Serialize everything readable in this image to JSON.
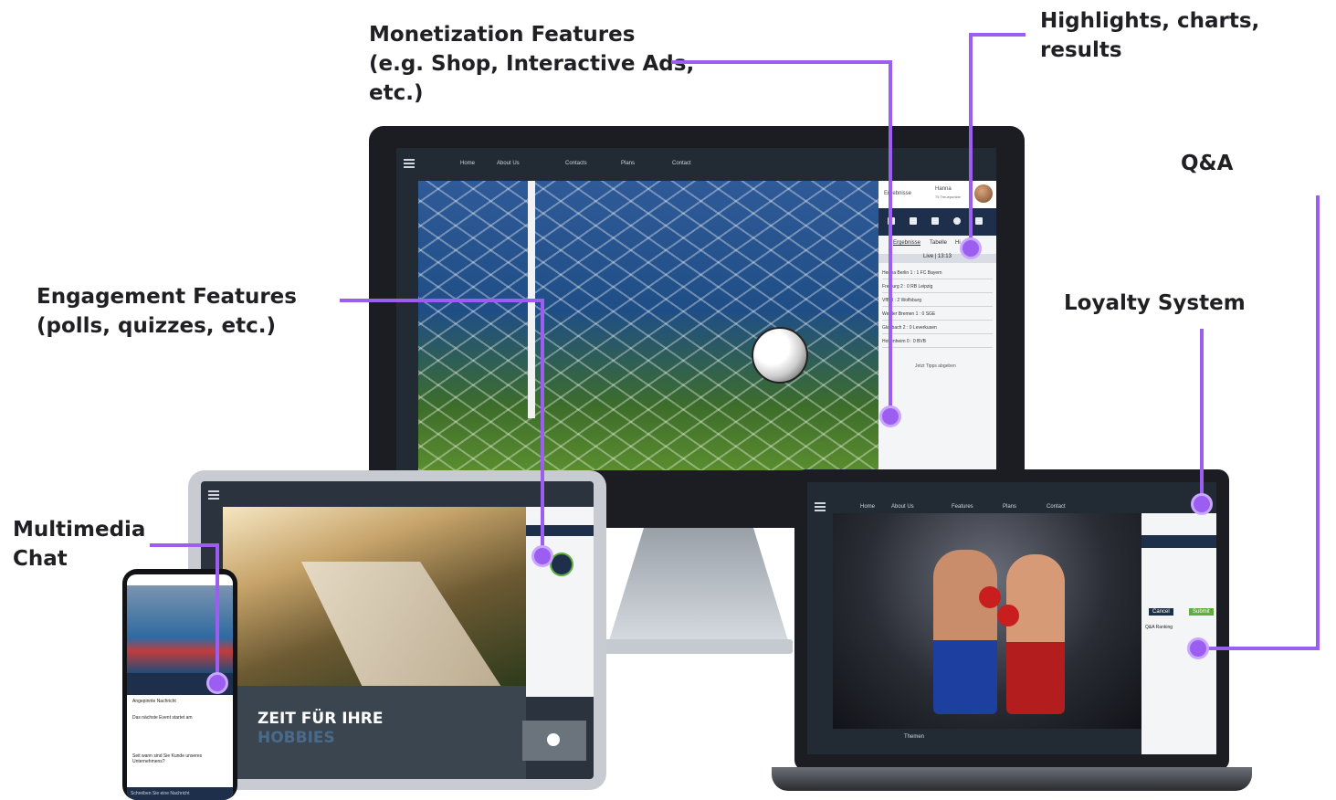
{
  "callouts": {
    "monetization": "Monetization Features\n(e.g. Shop, Interactive Ads,\netc.)",
    "highlights": "Highlights, charts, results",
    "qa": "Q&A",
    "engagement": "Engagement Features\n(polls, quizzes, etc.)",
    "loyalty": "Loyalty System",
    "multimedia": "Multimedia\nChat"
  },
  "colors": {
    "accent": "#9b5ef0",
    "navy": "#1d2f4a"
  },
  "monitor": {
    "nav": [
      "Home",
      "About Us",
      "Contacts",
      "Plans",
      "Contact"
    ],
    "panel": {
      "user": "Hanna",
      "points": "75 Treuepunkte",
      "title": "Ergebnisse",
      "subtabs": [
        "Ergebnisse",
        "Tabelle",
        "Hi"
      ],
      "live": "Live | 13:13",
      "matches": [
        "Hertha Berlin  1 : 1  FC Bayern",
        "Freiburg  2 : 0  RB Leipzig",
        "VfB  3 : 2  Wolfsburg",
        "Werder Bremen  1 : 0  SGE",
        "Gladbach  2 : 0  Leverkusen",
        "Hoffenheim  0 : 0  BVB"
      ],
      "tip": "Jetzt Tipps abgeben"
    }
  },
  "tablet": {
    "hero_title": "ZEIT FÜR IHRE",
    "hero_sub": "HOBBIES"
  },
  "laptop": {
    "nav": [
      "Home",
      "About Us",
      "Features",
      "Plans",
      "Contact"
    ],
    "panel": {
      "title": "Q&A Ranking",
      "cancel": "Cancel",
      "submit": "Submit"
    },
    "footer": "Themen"
  },
  "phone": {
    "pinned": "Angepinnte Nachricht",
    "msg1": "Das nächste Event startet am",
    "msg2": "Seit wann sind Sie Kunde unseres Unternehmens?",
    "input": "Schreiben Sie eine Nachricht"
  }
}
